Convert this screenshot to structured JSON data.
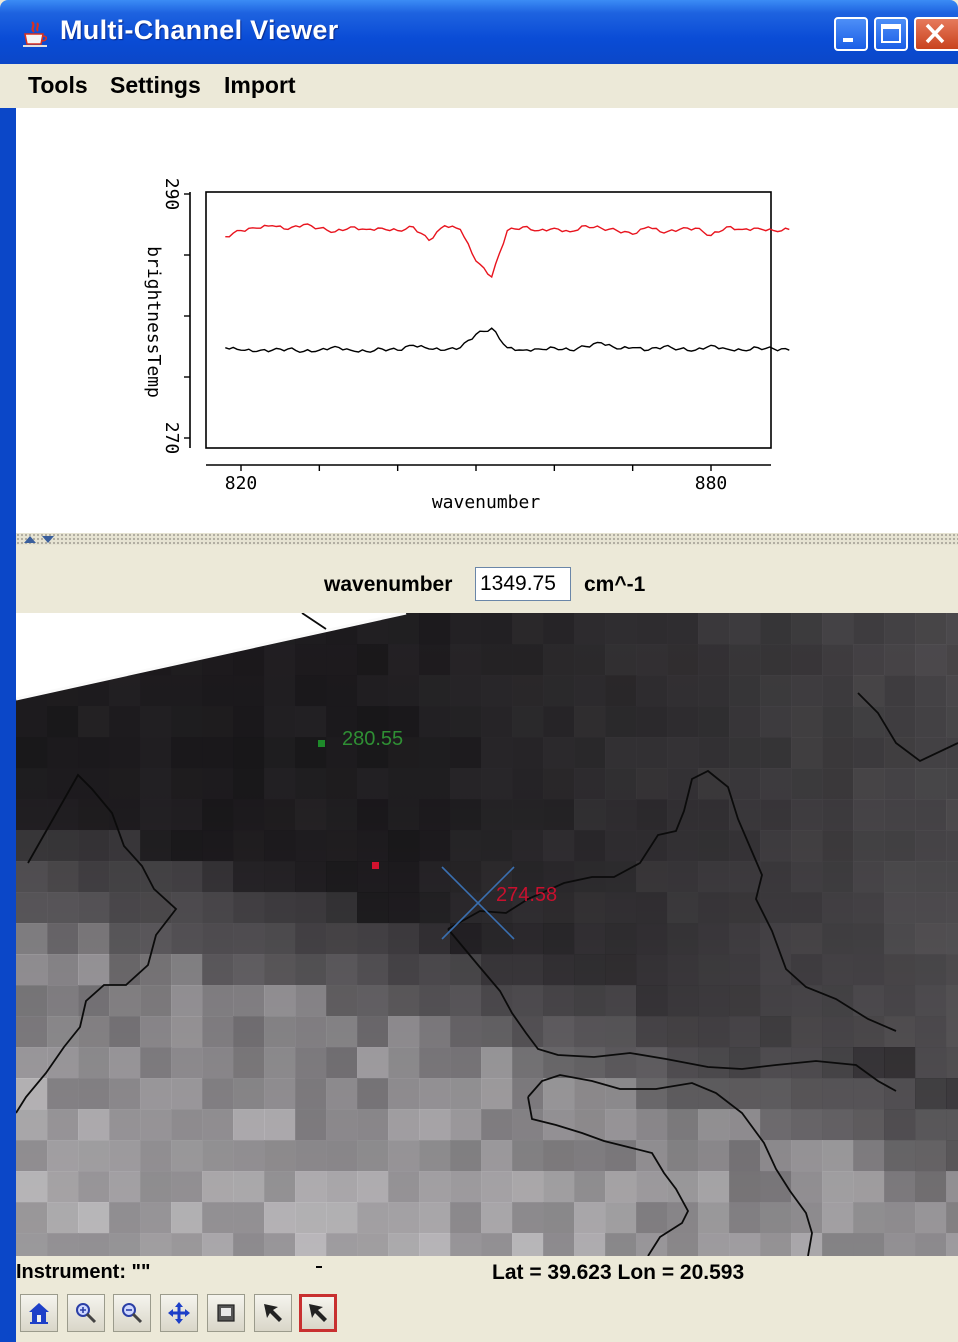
{
  "window": {
    "title": "Multi-Channel Viewer",
    "icon": "java-cup-icon",
    "controls": [
      "minimize-icon",
      "maximize-icon",
      "close-icon"
    ]
  },
  "menu": {
    "items": [
      "Tools",
      "Settings",
      "Import"
    ]
  },
  "chart_data": {
    "type": "line",
    "xlabel": "wavenumber",
    "ylabel": "brightnessTemp",
    "x_ticks": [
      "820",
      "880"
    ],
    "y_ticks": [
      "290",
      "270"
    ],
    "xlim": [
      818,
      890
    ],
    "ylim": [
      268,
      292
    ],
    "series": [
      {
        "color": "#e8141e",
        "x": [
          818,
          820,
          822,
          824,
          826,
          828,
          830,
          832,
          834,
          836,
          838,
          840,
          842,
          844,
          846,
          848,
          850,
          852,
          854,
          856,
          858,
          860,
          862,
          864,
          866,
          868,
          870,
          872,
          874,
          876,
          878,
          880,
          882,
          884,
          886,
          888,
          890
        ],
        "y": [
          286.5,
          287,
          287.2,
          287.4,
          287.1,
          287.5,
          287.2,
          286.9,
          287.3,
          287.1,
          287.2,
          287,
          287.3,
          286.2,
          287.4,
          287.1,
          284.5,
          283.2,
          287,
          287.3,
          287,
          287.2,
          286.9,
          287.4,
          287.2,
          287,
          286.7,
          287.3,
          286.8,
          287.1,
          287.2,
          286.6,
          287.3,
          287.1,
          287.2,
          287,
          287.1
        ]
      },
      {
        "color": "#000000",
        "x": [
          818,
          820,
          822,
          824,
          826,
          828,
          830,
          832,
          834,
          836,
          838,
          840,
          842,
          844,
          846,
          848,
          850,
          852,
          854,
          856,
          858,
          860,
          862,
          864,
          866,
          868,
          870,
          872,
          874,
          876,
          878,
          880,
          882,
          884,
          886,
          888,
          890
        ],
        "y": [
          277.4,
          277.2,
          277.1,
          277.2,
          277.3,
          277.1,
          277.2,
          277.5,
          277.2,
          277.1,
          277.3,
          277.2,
          277.6,
          277.3,
          277.2,
          277.4,
          278.5,
          279,
          277.4,
          277.2,
          277.3,
          277.4,
          277.2,
          277.5,
          277.8,
          277.3,
          277.4,
          277.2,
          277.5,
          277.3,
          277.2,
          277.6,
          277.3,
          277.2,
          277.4,
          277.3,
          277.2
        ]
      }
    ],
    "grid": false
  },
  "wavenumber": {
    "label": "wavenumber",
    "value": "1349.75",
    "unit": "cm^-1"
  },
  "map": {
    "probe_green_value": "280.55",
    "probe_red_value": "274.58",
    "colors": {
      "probe_green": "#1e8a2a",
      "probe_red": "#c8102e",
      "crosshair": "#3a6fb0"
    }
  },
  "status": {
    "instrument": "Instrument: \"\"",
    "latlon": "Lat = 39.623  Lon = 20.593"
  },
  "toolbar": {
    "buttons": [
      "home-icon",
      "zoom-in-icon",
      "zoom-out-icon",
      "pan-icon",
      "select-box-icon",
      "pointer-icon",
      "probe-pointer-icon"
    ]
  }
}
